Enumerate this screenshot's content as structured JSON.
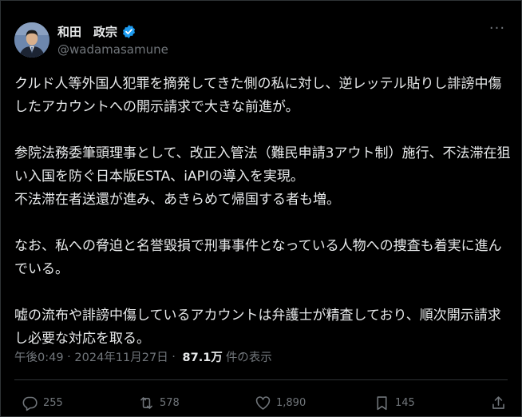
{
  "author": {
    "display_name": "和田　政宗",
    "handle": "@wadamasamune",
    "verified": true,
    "verified_color": "#1d9bf0"
  },
  "more_label": "···",
  "tweet": {
    "paragraphs": [
      "クルド人等外国人犯罪を摘発してきた側の私に対し、逆レッテル貼りし誹謗中傷したアカウントへの開示請求で大きな前進が。",
      "参院法務委筆頭理事として、改正入管法（難民申請3アウト制）施行、不法滞在狙い入国を防ぐ日本版ESTA、iAPIの導入を実現。\n不法滞在者送還が進み、あきらめて帰国する者も増。",
      "なお、私への脅迫と名誉毀損で刑事事件となっている人物への捜査も着実に進んでいる。",
      "嘘の流布や誹謗中傷しているアカウントは弁護士が精査しており、順次開示請求し必要な対応を取る。"
    ]
  },
  "meta": {
    "time": "午後0:49",
    "separator": " · ",
    "date": "2024年11月27日",
    "separator2": " · ",
    "views_count": "87.1万",
    "views_label": "件の表示"
  },
  "actions": {
    "replies": "255",
    "reposts": "578",
    "likes": "1,890",
    "bookmarks": "145"
  },
  "colors": {
    "background": "#000000",
    "text": "#e7e9ea",
    "muted": "#71767b",
    "border": "#2f3336"
  }
}
